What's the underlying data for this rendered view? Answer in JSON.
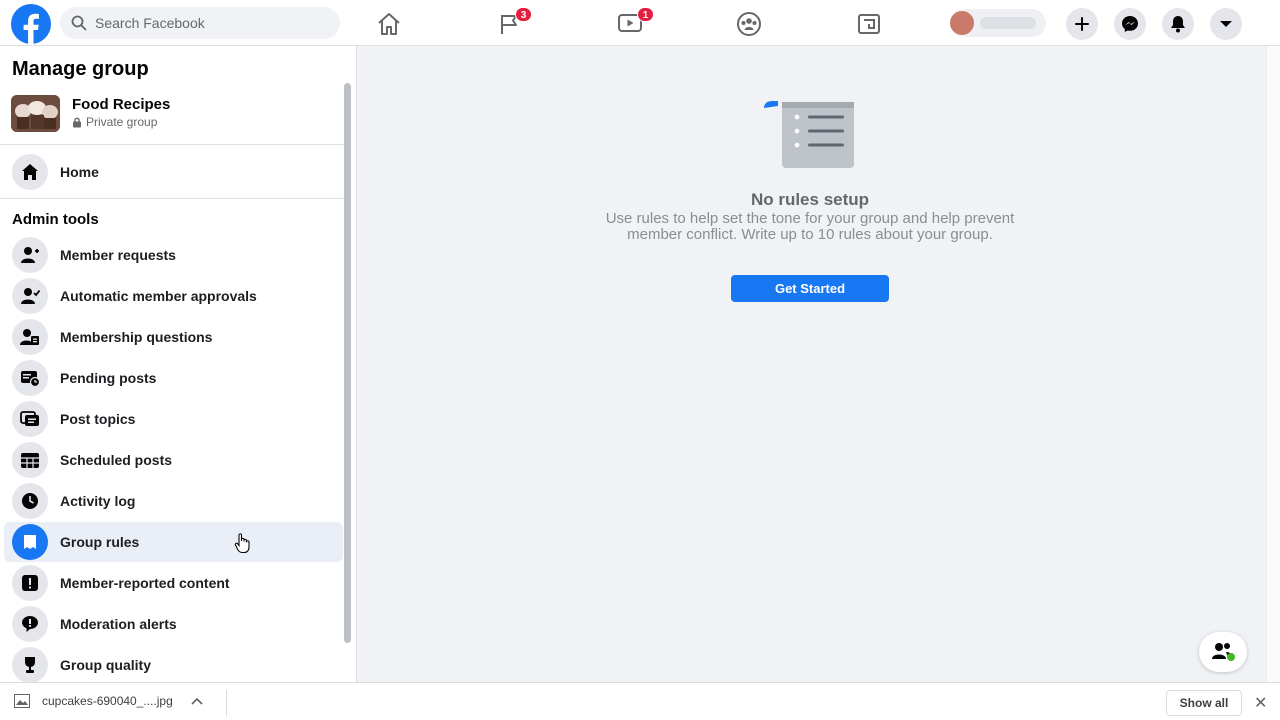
{
  "topbar": {
    "search_placeholder": "Search Facebook",
    "nav": [
      {
        "name": "home",
        "badge": null
      },
      {
        "name": "pages",
        "badge": "3"
      },
      {
        "name": "watch",
        "badge": "1"
      },
      {
        "name": "groups",
        "badge": null
      },
      {
        "name": "gaming",
        "badge": null
      }
    ]
  },
  "sidebar": {
    "title": "Manage group",
    "group": {
      "name": "Food Recipes",
      "privacy": "Private group"
    },
    "home_label": "Home",
    "section_title": "Admin tools",
    "items": [
      {
        "label": "Member requests",
        "icon": "member-requests-icon"
      },
      {
        "label": "Automatic member approvals",
        "icon": "auto-approvals-icon"
      },
      {
        "label": "Membership questions",
        "icon": "membership-questions-icon"
      },
      {
        "label": "Pending posts",
        "icon": "pending-posts-icon"
      },
      {
        "label": "Post topics",
        "icon": "post-topics-icon"
      },
      {
        "label": "Scheduled posts",
        "icon": "scheduled-posts-icon"
      },
      {
        "label": "Activity log",
        "icon": "clock-icon"
      },
      {
        "label": "Group rules",
        "icon": "rules-icon",
        "active": true
      },
      {
        "label": "Member-reported content",
        "icon": "alert-icon"
      },
      {
        "label": "Moderation alerts",
        "icon": "speech-bubble-icon"
      },
      {
        "label": "Group quality",
        "icon": "trophy-icon"
      }
    ]
  },
  "main": {
    "empty_title": "No rules setup",
    "empty_desc": "Use rules to help set the tone for your group and help prevent member conflict. Write up to 10 rules about your group.",
    "cta": "Get Started"
  },
  "download": {
    "file_name": "cupcakes-690040_....jpg",
    "show_all": "Show all"
  },
  "colors": {
    "accent": "#1877f2",
    "badge": "#e41e3f"
  }
}
